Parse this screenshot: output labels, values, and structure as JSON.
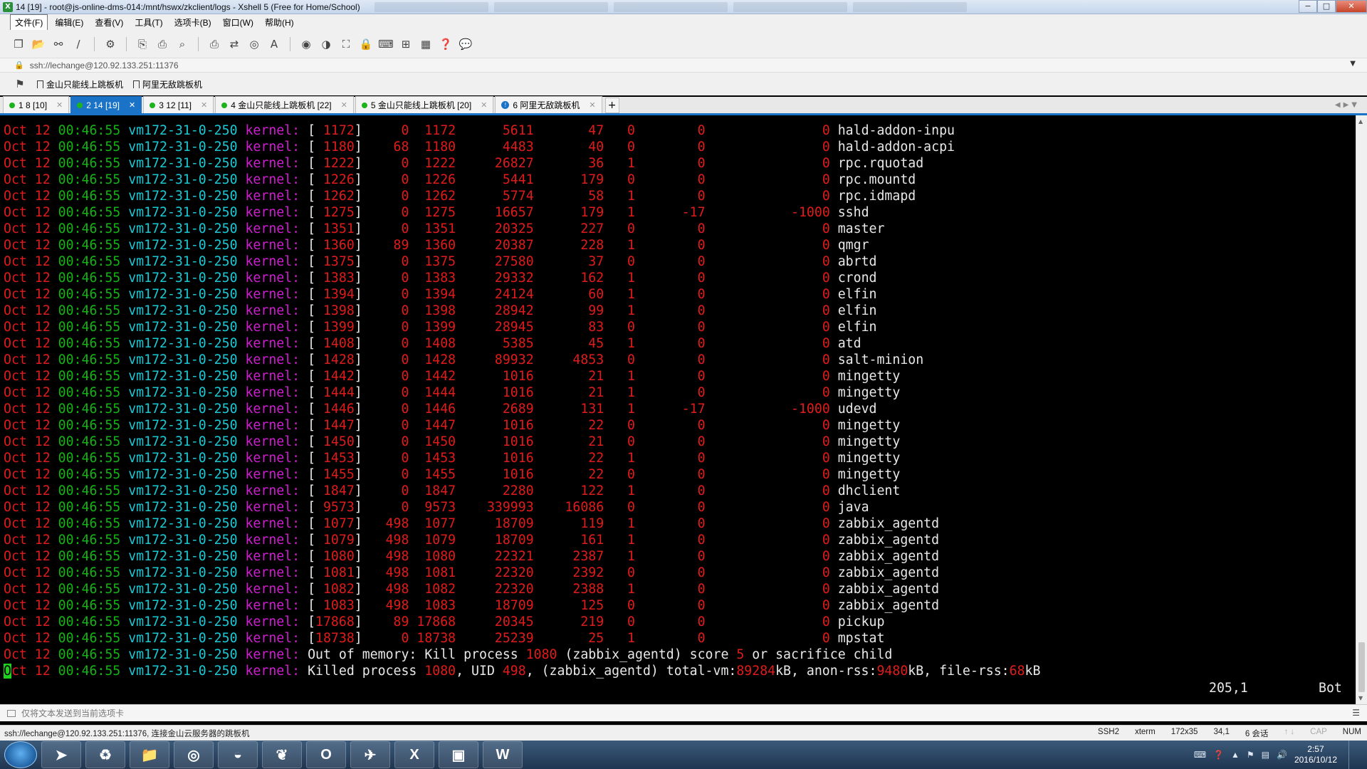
{
  "window": {
    "title": "14 [19] - root@js-online-dms-014:/mnt/hswx/zkclient/logs - Xshell 5 (Free for Home/School)",
    "controls": [
      "−",
      "□",
      "✕"
    ]
  },
  "menu": [
    "文件(F)",
    "编辑(E)",
    "查看(V)",
    "工具(T)",
    "选项卡(B)",
    "窗口(W)",
    "帮助(H)"
  ],
  "address": "ssh://lechange@120.92.133.251:11376",
  "links": [
    "金山只能线上跳板机",
    "阿里无敌跳板机"
  ],
  "tabs": [
    {
      "label": "1 8 [10]",
      "active": false
    },
    {
      "label": "2 14 [19]",
      "active": true
    },
    {
      "label": "3 12 [11]",
      "active": false
    },
    {
      "label": "4 金山只能线上跳板机 [22]",
      "active": false
    },
    {
      "label": "5 金山只能线上跳板机 [20]",
      "active": false
    },
    {
      "label": "6 阿里无敌跳板机",
      "active": false,
      "info": true
    }
  ],
  "terminal": {
    "prefix": {
      "month": "Oct",
      "day": "12",
      "time": "00:46:55",
      "host": "vm172-31-0-250",
      "tag": "kernel:"
    },
    "rows": [
      [
        "1172",
        "0",
        "1172",
        "5611",
        "47",
        "0",
        "0",
        "0",
        "hald-addon-inpu"
      ],
      [
        "1180",
        "68",
        "1180",
        "4483",
        "40",
        "0",
        "0",
        "0",
        "hald-addon-acpi"
      ],
      [
        "1222",
        "0",
        "1222",
        "26827",
        "36",
        "1",
        "0",
        "0",
        "rpc.rquotad"
      ],
      [
        "1226",
        "0",
        "1226",
        "5441",
        "179",
        "0",
        "0",
        "0",
        "rpc.mountd"
      ],
      [
        "1262",
        "0",
        "1262",
        "5774",
        "58",
        "1",
        "0",
        "0",
        "rpc.idmapd"
      ],
      [
        "1275",
        "0",
        "1275",
        "16657",
        "179",
        "1",
        "-17",
        "-1000",
        "sshd"
      ],
      [
        "1351",
        "0",
        "1351",
        "20325",
        "227",
        "0",
        "0",
        "0",
        "master"
      ],
      [
        "1360",
        "89",
        "1360",
        "20387",
        "228",
        "1",
        "0",
        "0",
        "qmgr"
      ],
      [
        "1375",
        "0",
        "1375",
        "27580",
        "37",
        "0",
        "0",
        "0",
        "abrtd"
      ],
      [
        "1383",
        "0",
        "1383",
        "29332",
        "162",
        "1",
        "0",
        "0",
        "crond"
      ],
      [
        "1394",
        "0",
        "1394",
        "24124",
        "60",
        "1",
        "0",
        "0",
        "elfin"
      ],
      [
        "1398",
        "0",
        "1398",
        "28942",
        "99",
        "1",
        "0",
        "0",
        "elfin"
      ],
      [
        "1399",
        "0",
        "1399",
        "28945",
        "83",
        "0",
        "0",
        "0",
        "elfin"
      ],
      [
        "1408",
        "0",
        "1408",
        "5385",
        "45",
        "1",
        "0",
        "0",
        "atd"
      ],
      [
        "1428",
        "0",
        "1428",
        "89932",
        "4853",
        "0",
        "0",
        "0",
        "salt-minion"
      ],
      [
        "1442",
        "0",
        "1442",
        "1016",
        "21",
        "1",
        "0",
        "0",
        "mingetty"
      ],
      [
        "1444",
        "0",
        "1444",
        "1016",
        "21",
        "1",
        "0",
        "0",
        "mingetty"
      ],
      [
        "1446",
        "0",
        "1446",
        "2689",
        "131",
        "1",
        "-17",
        "-1000",
        "udevd"
      ],
      [
        "1447",
        "0",
        "1447",
        "1016",
        "22",
        "0",
        "0",
        "0",
        "mingetty"
      ],
      [
        "1450",
        "0",
        "1450",
        "1016",
        "21",
        "0",
        "0",
        "0",
        "mingetty"
      ],
      [
        "1453",
        "0",
        "1453",
        "1016",
        "22",
        "1",
        "0",
        "0",
        "mingetty"
      ],
      [
        "1455",
        "0",
        "1455",
        "1016",
        "22",
        "0",
        "0",
        "0",
        "mingetty"
      ],
      [
        "1847",
        "0",
        "1847",
        "2280",
        "122",
        "1",
        "0",
        "0",
        "dhclient"
      ],
      [
        "9573",
        "0",
        "9573",
        "339993",
        "16086",
        "0",
        "0",
        "0",
        "java"
      ],
      [
        "1077",
        "498",
        "1077",
        "18709",
        "119",
        "1",
        "0",
        "0",
        "zabbix_agentd"
      ],
      [
        "1079",
        "498",
        "1079",
        "18709",
        "161",
        "1",
        "0",
        "0",
        "zabbix_agentd"
      ],
      [
        "1080",
        "498",
        "1080",
        "22321",
        "2387",
        "1",
        "0",
        "0",
        "zabbix_agentd"
      ],
      [
        "1081",
        "498",
        "1081",
        "22320",
        "2392",
        "0",
        "0",
        "0",
        "zabbix_agentd"
      ],
      [
        "1082",
        "498",
        "1082",
        "22320",
        "2388",
        "1",
        "0",
        "0",
        "zabbix_agentd"
      ],
      [
        "1083",
        "498",
        "1083",
        "18709",
        "125",
        "0",
        "0",
        "0",
        "zabbix_agentd"
      ],
      [
        "17868",
        "89",
        "17868",
        "20345",
        "219",
        "0",
        "0",
        "0",
        "pickup"
      ],
      [
        "18738",
        "0",
        "18738",
        "25239",
        "25",
        "1",
        "0",
        "0",
        "mpstat"
      ]
    ],
    "oom_line": {
      "a": "Out of memory: Kill process ",
      "pid": "1080",
      "b": " (zabbix_agentd) score ",
      "score": "5",
      "c": " or sacrifice child"
    },
    "killed_line": {
      "a": "Killed process ",
      "pid": "1080",
      "b": ", UID ",
      "uid": "498",
      "c": ", (zabbix_agentd) total-vm:",
      "vm": "89284",
      "d": "kB, anon-rss:",
      "anon": "9480",
      "e": "kB, file-rss:",
      "file": "68",
      "f": "kB"
    },
    "cursor_pos": "205,1",
    "scroll_pos": "Bot"
  },
  "compose": {
    "placeholder": "仅将文本发送到当前选项卡"
  },
  "status": {
    "left": "ssh://lechange@120.92.133.251:11376, 连接金山云服务器的跳板机",
    "protocol": "SSH2",
    "term": "xterm",
    "size": "172x35",
    "pos": "34,1",
    "sessions": "6 会话",
    "cap": "CAP",
    "num": "NUM"
  },
  "taskbar": {
    "apps": [
      "start-menu",
      "feather-icon",
      "recycle-icon",
      "folder-icon",
      "chrome-icon",
      "firefox-icon",
      "bird-icon",
      "outlook-icon",
      "feiq-icon",
      "excel-icon",
      "xshell-icon",
      "word-icon"
    ],
    "labels": {
      "outlook": "O",
      "excel": "X",
      "word": "W"
    },
    "time": "2:57",
    "date": "2016/10/12"
  }
}
